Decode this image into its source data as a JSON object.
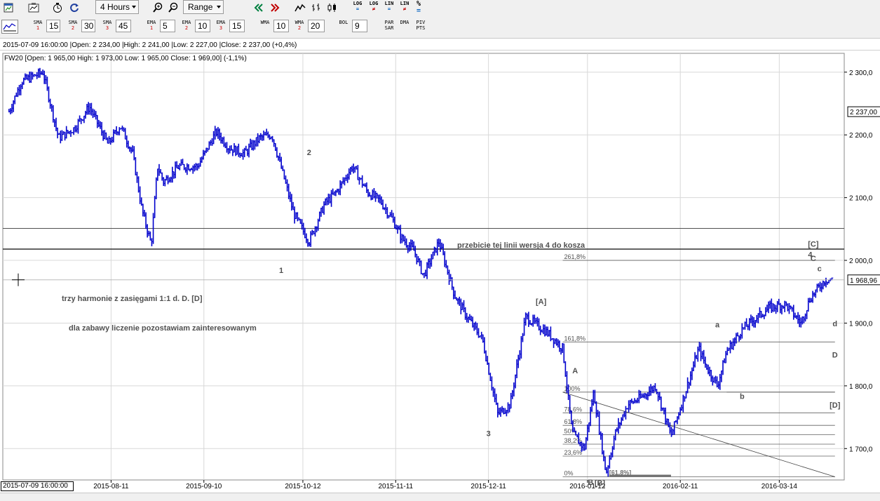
{
  "toolbar": {
    "timeframe": "4 Hours",
    "range_label": "Range",
    "log_labels": [
      [
        "LOG",
        "="
      ],
      [
        "LOG",
        "≠"
      ],
      [
        "LIN",
        "="
      ],
      [
        "LIN",
        "≠"
      ]
    ],
    "percent_label": "%",
    "icons": [
      "window-icon",
      "new-chart-icon",
      "clock-refresh-icon",
      "refresh-icon",
      "zoom-in-icon",
      "zoom-out-icon",
      "scroll-left-icon",
      "scroll-right-icon",
      "line-chart-icon",
      "bar-chart-icon",
      "candle-chart-icon"
    ]
  },
  "indicators": {
    "sma": [
      {
        "label": "SMA",
        "num": "1",
        "value": "15"
      },
      {
        "label": "SMA",
        "num": "2",
        "value": "30"
      },
      {
        "label": "SMA",
        "num": "3",
        "value": "45"
      }
    ],
    "ema": [
      {
        "label": "EMA",
        "num": "1",
        "value": "5"
      },
      {
        "label": "EMA",
        "num": "2",
        "value": "10"
      },
      {
        "label": "EMA",
        "num": "3",
        "value": "15"
      }
    ],
    "wma": [
      {
        "label": "WMA",
        "num": "",
        "value": "10"
      },
      {
        "label": "WMA",
        "num": "2",
        "value": "20"
      }
    ],
    "bol": {
      "label": "BOL",
      "value": "9"
    },
    "par": [
      "PAR",
      "SAR"
    ],
    "dma": "DMA",
    "piv": [
      "PIV",
      "PTS"
    ]
  },
  "info_line": "2015-07-09 16:00:00 |Open: 2 234,00 |High: 2 241,00 |Low: 2 227,00 |Close: 2 237,00 (+0,4%)",
  "chart_header": "FW20 [Open: 1 965,00  High: 1 973,00  Low: 1 965,00  Close: 1 969,00] (-1,1%)",
  "cursor_time": "2015-07-09 16:00:00",
  "colors": {
    "series": "#0000cc",
    "grid": "#d8d8d8",
    "line": "#404040",
    "label": "#505050"
  },
  "chart_data": {
    "type": "bar",
    "title": "FW20",
    "x_ticks": [
      "2015-08-11",
      "2015-09-10",
      "2015-10-12",
      "2015-11-11",
      "2015-12-11",
      "2016-01-12",
      "2016-02-11",
      "2016-03-14"
    ],
    "y_ticks": [
      "2 300,0",
      "2 200,0",
      "2 100,0",
      "2 000,0",
      "1 900,0",
      "1 800,0",
      "1 700,0"
    ],
    "ylim": [
      1650,
      2330
    ],
    "price_tags": [
      {
        "label": "2 237,00",
        "value": 2237
      },
      {
        "label": "1 968,96",
        "value": 1968.96
      }
    ],
    "horizontal_levels": [
      2051,
      2018
    ],
    "series": [
      {
        "x": [
          "2015-07-09",
          "2015-07-13",
          "2015-07-20",
          "2015-07-25",
          "2015-07-30",
          "2015-08-04",
          "2015-08-10",
          "2015-08-14",
          "2015-08-18",
          "2015-08-21",
          "2015-08-24",
          "2015-08-26",
          "2015-08-28",
          "2015-09-02",
          "2015-09-08",
          "2015-09-14",
          "2015-09-18",
          "2015-09-23",
          "2015-09-28",
          "2015-10-02",
          "2015-10-06",
          "2015-10-09",
          "2015-10-14",
          "2015-10-19",
          "2015-10-23",
          "2015-10-28",
          "2015-11-02",
          "2015-11-06",
          "2015-11-10",
          "2015-11-13",
          "2015-11-17",
          "2015-11-20",
          "2015-11-25",
          "2015-11-30",
          "2015-12-04",
          "2015-12-09",
          "2015-12-14",
          "2015-12-18",
          "2015-12-23",
          "2015-12-30",
          "2016-01-04",
          "2016-01-07",
          "2016-01-11",
          "2016-01-14",
          "2016-01-18",
          "2016-01-21",
          "2016-01-25",
          "2016-01-29",
          "2016-02-03",
          "2016-02-08",
          "2016-02-12",
          "2016-02-17",
          "2016-02-19",
          "2016-02-23",
          "2016-02-26",
          "2016-03-02",
          "2016-03-07",
          "2016-03-11",
          "2016-03-16",
          "2016-03-21",
          "2016-03-24",
          "2016-03-29",
          "2016-03-31"
        ],
        "values": [
          2237,
          2285,
          2300,
          2195,
          2210,
          2245,
          2185,
          2215,
          2170,
          2080,
          2025,
          2150,
          2125,
          2150,
          2150,
          2205,
          2180,
          2170,
          2195,
          2200,
          2130,
          2075,
          2030,
          2090,
          2110,
          2150,
          2108,
          2095,
          2065,
          2035,
          2015,
          1975,
          2030,
          1945,
          1910,
          1875,
          1755,
          1770,
          1910,
          1885,
          1860,
          1725,
          1700,
          1790,
          1660,
          1725,
          1770,
          1780,
          1800,
          1720,
          1780,
          1860,
          1835,
          1800,
          1855,
          1890,
          1910,
          1925,
          1930,
          1900,
          1940,
          1970,
          1969
        ]
      }
    ],
    "fib_upper": [
      {
        "label": "261,8%",
        "value": 2000
      },
      {
        "label": "161,8%",
        "value": 1870
      }
    ],
    "fib_lower": [
      {
        "label": "100%",
        "value": 1790
      },
      {
        "label": "78,6%",
        "value": 1757
      },
      {
        "label": "61,8%",
        "value": 1737
      },
      {
        "label": "50%",
        "value": 1722
      },
      {
        "label": "38,2%",
        "value": 1707
      },
      {
        "label": "23,6%",
        "value": 1688
      },
      {
        "label": "0%",
        "value": 1655
      }
    ],
    "level_b": 1790,
    "wave_labels": [
      {
        "text": "1",
        "date": "2015-10-05",
        "value": 1980
      },
      {
        "text": "2",
        "date": "2015-10-14",
        "value": 2168
      },
      {
        "text": "3",
        "date": "2015-12-11",
        "value": 1720
      },
      {
        "text": "[A]",
        "date": "2015-12-28",
        "value": 1930
      },
      {
        "text": "A",
        "date": "2016-01-08",
        "value": 1820
      },
      {
        "text": "B",
        "date": "2016-01-13",
        "value": 1642
      },
      {
        "text": "[B]",
        "date": "2016-01-16",
        "value": 1641
      },
      {
        "text": "a",
        "date": "2016-02-23",
        "value": 1893
      },
      {
        "text": "b",
        "date": "2016-03-02",
        "value": 1779
      },
      {
        "text": "4",
        "date": "2016-03-24",
        "value": 2005
      },
      {
        "text": "[C]",
        "date": "2016-03-25",
        "value": 2022
      },
      {
        "text": "C",
        "date": "2016-03-25",
        "value": 1999
      },
      {
        "text": "c",
        "date": "2016-03-27",
        "value": 1983
      },
      {
        "text": "d",
        "date": "2016-04-01",
        "value": 1895
      },
      {
        "text": "D",
        "date": "2016-04-01",
        "value": 1845
      },
      {
        "text": "[D]",
        "date": "2016-04-01",
        "value": 1765
      }
    ],
    "annotations": [
      "przebicie tej linii wersja 4 do kosza",
      "trzy harmonie z zasięgami 1:1 d. D. [D]",
      "dla zabawy liczenie pozostawiam zainteresowanym"
    ],
    "fib_stack_label": "[61,8%]"
  }
}
